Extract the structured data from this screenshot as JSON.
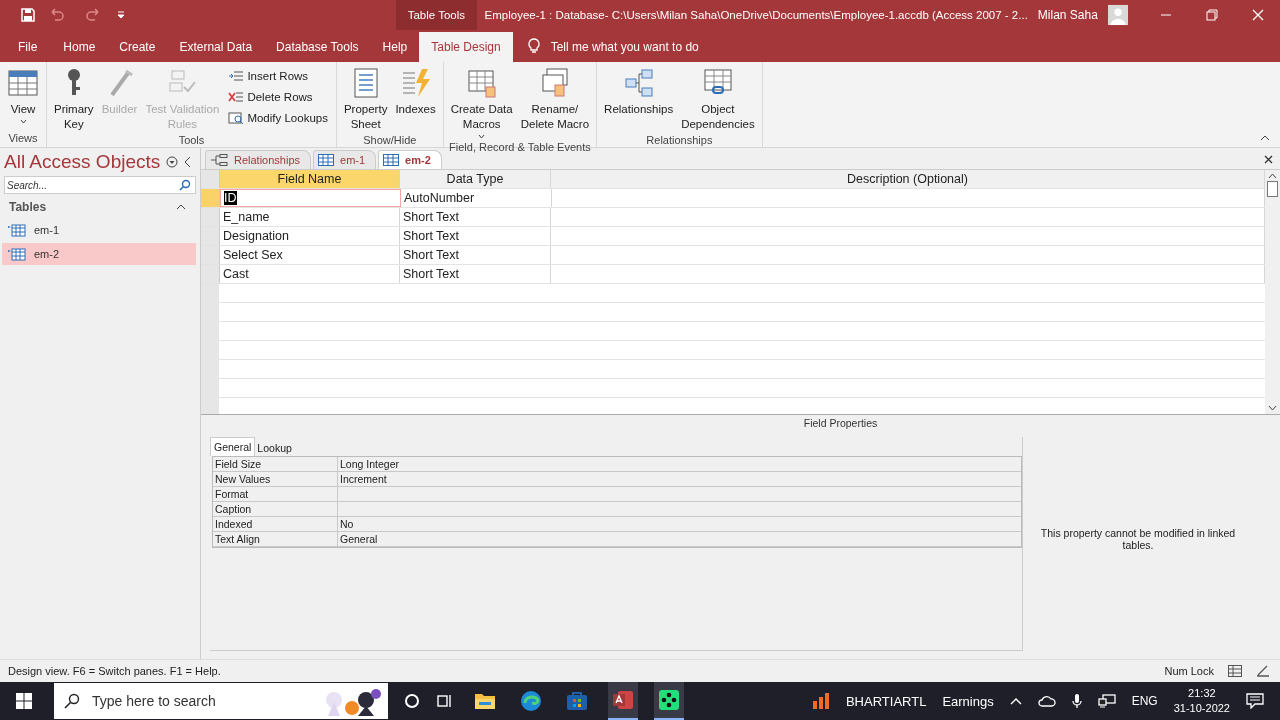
{
  "title_bar": {
    "context_tab": "Table Tools",
    "title": "Employee-1 : Database- C:\\Users\\Milan Saha\\OneDrive\\Documents\\Employee-1.accdb (Access 2007 - 2...",
    "user": "Milan Saha"
  },
  "ribbon_tabs": [
    {
      "label": "File",
      "selected": false
    },
    {
      "label": "Home",
      "selected": false
    },
    {
      "label": "Create",
      "selected": false
    },
    {
      "label": "External Data",
      "selected": false
    },
    {
      "label": "Database Tools",
      "selected": false
    },
    {
      "label": "Help",
      "selected": false
    },
    {
      "label": "Table Design",
      "selected": true
    }
  ],
  "tell_me": "Tell me what you want to do",
  "ribbon_groups": [
    {
      "label": "Views",
      "buttons": [
        {
          "kind": "large",
          "label": "View",
          "disabled": false,
          "dropdown": true
        }
      ]
    },
    {
      "label": "Tools",
      "buttons": [
        {
          "kind": "large",
          "label": "Primary\nKey",
          "disabled": false
        },
        {
          "kind": "large",
          "label": "Builder",
          "disabled": true
        },
        {
          "kind": "large",
          "label": "Test Validation\nRules",
          "disabled": true
        },
        {
          "kind": "small",
          "label": "Insert Rows",
          "disabled": false
        },
        {
          "kind": "small",
          "label": "Delete Rows",
          "disabled": false
        },
        {
          "kind": "small",
          "label": "Modify Lookups",
          "disabled": false
        }
      ]
    },
    {
      "label": "Show/Hide",
      "buttons": [
        {
          "kind": "large",
          "label": "Property\nSheet",
          "disabled": false
        },
        {
          "kind": "large",
          "label": "Indexes",
          "disabled": false
        }
      ]
    },
    {
      "label": "Field, Record & Table Events",
      "buttons": [
        {
          "kind": "large",
          "label": "Create Data\nMacros",
          "disabled": false,
          "dropdown": true
        },
        {
          "kind": "large",
          "label": "Rename/\nDelete Macro",
          "disabled": false
        }
      ]
    },
    {
      "label": "Relationships",
      "buttons": [
        {
          "kind": "large",
          "label": "Relationships",
          "disabled": false
        },
        {
          "kind": "large",
          "label": "Object\nDependencies",
          "disabled": false
        }
      ]
    }
  ],
  "nav_pane": {
    "title": "All Access Objects",
    "search": {
      "placeholder": "Search..."
    },
    "group": "Tables",
    "items": [
      {
        "label": "em-1",
        "selected": false
      },
      {
        "label": "em-2",
        "selected": true
      }
    ]
  },
  "doc_tabs": [
    {
      "label": "Relationships",
      "kind": "relationships",
      "selected": false
    },
    {
      "label": "em-1",
      "kind": "table",
      "selected": false
    },
    {
      "label": "em-2",
      "kind": "table",
      "selected": true
    }
  ],
  "design_grid": {
    "columns": [
      "Field Name",
      "Data Type",
      "Description (Optional)"
    ],
    "rows": [
      {
        "field_name": "ID",
        "data_type": "AutoNumber",
        "current": true
      },
      {
        "field_name": "E_name",
        "data_type": "Short Text",
        "current": false
      },
      {
        "field_name": "Designation",
        "data_type": "Short Text",
        "current": false
      },
      {
        "field_name": "Select Sex",
        "data_type": "Short Text",
        "current": false
      },
      {
        "field_name": "Cast",
        "data_type": "Short Text",
        "current": false
      }
    ]
  },
  "field_properties": {
    "title": "Field Properties",
    "tabs": [
      {
        "label": "General",
        "selected": true
      },
      {
        "label": "Lookup",
        "selected": false
      }
    ],
    "properties": [
      {
        "name": "Field Size",
        "value": "Long Integer"
      },
      {
        "name": "New Values",
        "value": "Increment"
      },
      {
        "name": "Format"
      },
      {
        "name": "Caption"
      },
      {
        "name": "Indexed",
        "value": "No"
      },
      {
        "name": "Text Align",
        "value": "General"
      }
    ],
    "help": "This property cannot be modified in linked tables."
  },
  "status_bar": {
    "message": "Design view.  F6 = Switch panes.  F1 = Help.",
    "indicator": "Num Lock"
  },
  "taskbar": {
    "search": {
      "placeholder": "Type here to search"
    },
    "stock": {
      "symbol": "BHARTIARTL",
      "note": "Earnings"
    },
    "language": "ENG",
    "time": "21:32",
    "date": "31-10-2022"
  }
}
